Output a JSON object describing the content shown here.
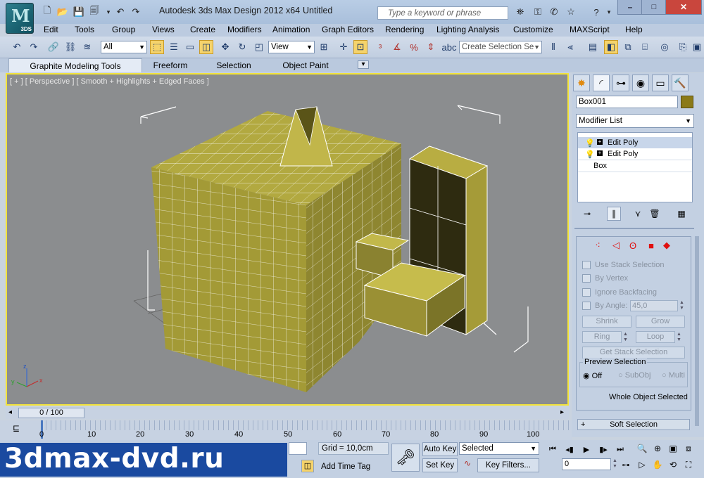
{
  "window": {
    "app_title": "Autodesk 3ds Max Design 2012 x64",
    "document_title": "Untitled",
    "logo_text": "M",
    "logo_badge": "3DS",
    "search_placeholder": "Type a keyword or phrase",
    "minimize": "–",
    "maximize": "□",
    "close": "✕"
  },
  "menu": [
    "Edit",
    "Tools",
    "Group",
    "Views",
    "Create",
    "Modifiers",
    "Animation",
    "Graph Editors",
    "Rendering",
    "Lighting Analysis",
    "Customize",
    "MAXScript",
    "Help"
  ],
  "toolbar": {
    "filter_value": "All",
    "refcoord_value": "View",
    "named_selection_placeholder": "Create Selection Se"
  },
  "ribbon": {
    "tabs": [
      "Graphite Modeling Tools",
      "Freeform",
      "Selection",
      "Object Paint"
    ],
    "expander": "▾"
  },
  "viewport": {
    "label": "[ + ] [ Perspective ] [ Smooth + Highlights + Edged Faces ]",
    "axis_x": "x",
    "axis_y": "y",
    "axis_z": "z"
  },
  "command_panel": {
    "object_name": "Box001",
    "object_color": "#8b7a18",
    "modifier_list": "Modifier List",
    "stack": [
      {
        "label": "Edit Poly",
        "selected": true
      },
      {
        "label": "Edit Poly",
        "selected": false
      },
      {
        "label": "Box",
        "selected": false
      }
    ],
    "selection": {
      "use_stack_selection": "Use Stack Selection",
      "by_vertex": "By Vertex",
      "ignore_backfacing": "Ignore Backfacing",
      "by_angle": "By Angle:",
      "angle_value": "45,0",
      "shrink": "Shrink",
      "grow": "Grow",
      "ring": "Ring",
      "loop": "Loop",
      "get_stack_selection": "Get Stack Selection",
      "preview_selection": "Preview Selection",
      "off": "Off",
      "subobj": "SubObj",
      "multi": "Multi",
      "status": "Whole Object Selected"
    },
    "soft_selection": "Soft Selection",
    "soft_selection_toggle": "+"
  },
  "timeline": {
    "slider_label": "0 / 100",
    "ticks": [
      "0",
      "10",
      "20",
      "30",
      "40",
      "50",
      "60",
      "70",
      "80",
      "90",
      "100"
    ],
    "current_frame_fraction": 0
  },
  "status": {
    "watermark": "3dmax-dvd.ru",
    "grid": "Grid = 10,0cm",
    "add_time_tag": "Add Time Tag",
    "auto_key": "Auto Key",
    "set_key": "Set Key",
    "selected_dropdown": "Selected",
    "key_filters": "Key Filters...",
    "current_frame": "0"
  },
  "colors": {
    "box_fill": "#a39a36",
    "box_wire": "#ffffff",
    "viewport_bg": "#8b8d8f",
    "active_border": "#f3e33a"
  }
}
